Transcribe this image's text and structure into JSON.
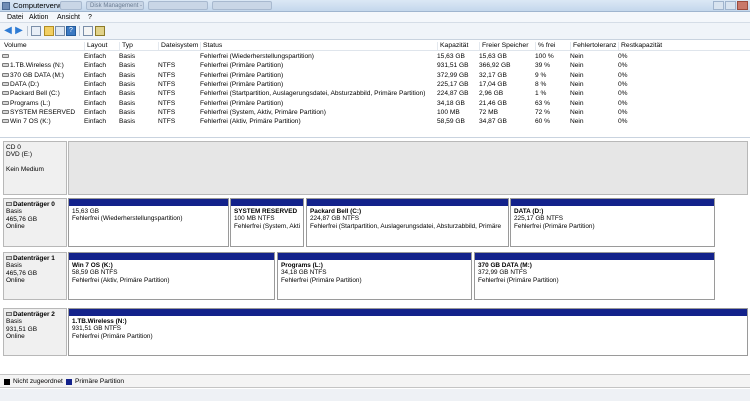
{
  "window": {
    "title": "Computerverwaltung",
    "bg_tabs": [
      "",
      "Disk Management - Post ...",
      "",
      ""
    ]
  },
  "menu": [
    "Datei",
    "Aktion",
    "Ansicht",
    "?"
  ],
  "toolbar": {
    "icons": [
      "back-arrow-icon",
      "forward-arrow-icon",
      "console-tree-icon",
      "folder-icon",
      "properties-icon",
      "help-icon",
      "disk-icon",
      "settings-icon"
    ]
  },
  "volume_list": {
    "headers": [
      "Volume",
      "Layout",
      "Typ",
      "Dateisystem",
      "Status",
      "Kapazität",
      "Freier Speicher",
      "% frei",
      "Fehlertoleranz",
      "Restkapazität"
    ],
    "rows": [
      [
        "",
        "Einfach",
        "Basis",
        "",
        "Fehlerfrei (Wiederherstellungspartition)",
        "15,63 GB",
        "15,63 GB",
        "100 %",
        "Nein",
        "0%"
      ],
      [
        "1.TB.Wireless (N:)",
        "Einfach",
        "Basis",
        "NTFS",
        "Fehlerfrei (Primäre Partition)",
        "931,51 GB",
        "366,92 GB",
        "39 %",
        "Nein",
        "0%"
      ],
      [
        "370 GB DATA (M:)",
        "Einfach",
        "Basis",
        "NTFS",
        "Fehlerfrei (Primäre Partition)",
        "372,99 GB",
        "32,17 GB",
        "9 %",
        "Nein",
        "0%"
      ],
      [
        "DATA (D:)",
        "Einfach",
        "Basis",
        "NTFS",
        "Fehlerfrei (Primäre Partition)",
        "225,17 GB",
        "17,04 GB",
        "8 %",
        "Nein",
        "0%"
      ],
      [
        "Packard Bell (C:)",
        "Einfach",
        "Basis",
        "NTFS",
        "Fehlerfrei (Startpartition, Auslagerungsdatei, Absturzabbild, Primäre Partition)",
        "224,87 GB",
        "2,96 GB",
        "1 %",
        "Nein",
        "0%"
      ],
      [
        "Programs (L:)",
        "Einfach",
        "Basis",
        "NTFS",
        "Fehlerfrei (Primäre Partition)",
        "34,18 GB",
        "21,46 GB",
        "63 %",
        "Nein",
        "0%"
      ],
      [
        "SYSTEM RESERVED",
        "Einfach",
        "Basis",
        "NTFS",
        "Fehlerfrei (System, Aktiv, Primäre Partition)",
        "100 MB",
        "72 MB",
        "72 %",
        "Nein",
        "0%"
      ],
      [
        "Win 7 OS (K:)",
        "Einfach",
        "Basis",
        "NTFS",
        "Fehlerfrei (Aktiv, Primäre Partition)",
        "58,59 GB",
        "34,87 GB",
        "60 %",
        "Nein",
        "0%"
      ]
    ]
  },
  "cd": {
    "name": "CD 0",
    "drive": "DVD (E:)",
    "status": "Kein Medium"
  },
  "disks": [
    {
      "name": "Datenträger 0",
      "type": "Basis",
      "size": "465,76 GB",
      "state": "Online",
      "partitions": [
        {
          "name": "",
          "size": "15,63 GB",
          "status": "Fehlerfrei (Wiederherstellungspartition)"
        },
        {
          "name": "SYSTEM RESERVED",
          "size": "100 MB NTFS",
          "status": "Fehlerfrei (System, Akti"
        },
        {
          "name": "Packard Bell  (C:)",
          "size": "224,87 GB NTFS",
          "status": "Fehlerfrei (Startpartition, Auslagerungsdatei, Absturzabbild, Primäre"
        },
        {
          "name": "DATA  (D:)",
          "size": "225,17 GB NTFS",
          "status": "Fehlerfrei (Primäre Partition)"
        }
      ]
    },
    {
      "name": "Datenträger 1",
      "type": "Basis",
      "size": "465,76 GB",
      "state": "Online",
      "partitions": [
        {
          "name": "Win 7 OS  (K:)",
          "size": "58,59 GB NTFS",
          "status": "Fehlerfrei (Aktiv, Primäre Partition)"
        },
        {
          "name": "Programs  (L:)",
          "size": "34,18 GB NTFS",
          "status": "Fehlerfrei (Primäre Partition)"
        },
        {
          "name": "370 GB DATA  (M:)",
          "size": "372,99 GB NTFS",
          "status": "Fehlerfrei (Primäre Partition)"
        }
      ]
    },
    {
      "name": "Datenträger 2",
      "type": "Basis",
      "size": "931,51 GB",
      "state": "Online",
      "partitions": [
        {
          "name": "1.TB.Wireless  (N:)",
          "size": "931,51 GB NTFS",
          "status": "Fehlerfrei (Primäre Partition)"
        }
      ]
    }
  ],
  "legend": [
    {
      "label": "Nicht zugeordnet",
      "color": "#000000"
    },
    {
      "label": "Primäre Partition",
      "color": "#13228b"
    }
  ],
  "colors": {
    "primary_partition_bar": "#13228b",
    "unallocated": "#000000"
  }
}
